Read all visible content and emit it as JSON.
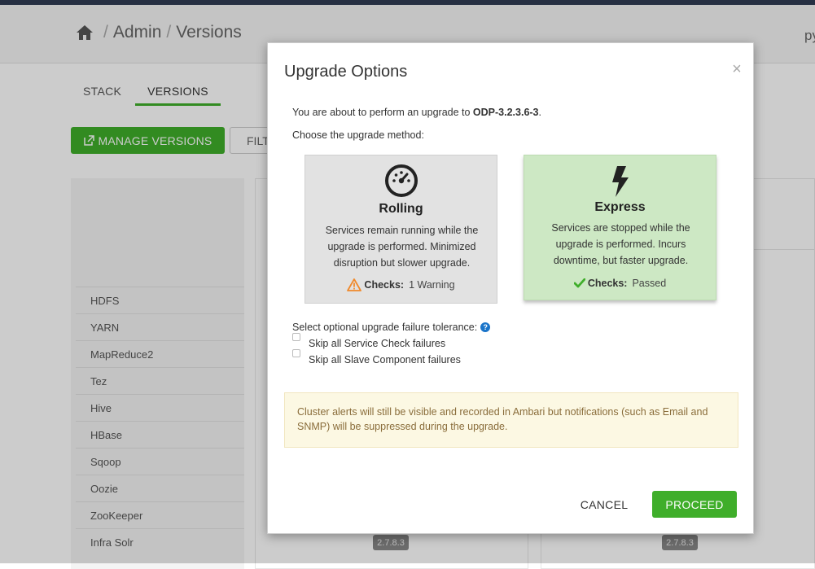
{
  "breadcrumb": {
    "home_icon": "home-icon",
    "items": [
      "Admin",
      "Versions"
    ],
    "separator": "/"
  },
  "header": {
    "user_text": "py"
  },
  "tabs": [
    {
      "label": "STACK",
      "active": false
    },
    {
      "label": "VERSIONS",
      "active": true
    }
  ],
  "toolbar": {
    "manage_versions_label": "MANAGE VERSIONS",
    "manage_versions_icon": "external-link-icon",
    "filter_label": "FILT"
  },
  "services": [
    "HDFS",
    "YARN",
    "MapReduce2",
    "Tez",
    "Hive",
    "HBase",
    "Sqoop",
    "Oozie",
    "ZooKeeper",
    "Infra Solr"
  ],
  "versions": {
    "infra_solr_version_col1": "2.7.8.3",
    "infra_solr_version_col2": "2.7.8.3"
  },
  "modal": {
    "title": "Upgrade Options",
    "close_icon": "close-icon",
    "intro_prefix": "You are about to perform an upgrade to ",
    "intro_version": "ODP-3.2.3.6-3",
    "intro_suffix": ".",
    "choose_text": "Choose the upgrade method:",
    "rolling": {
      "icon": "dashboard-gauge-icon",
      "name": "Rolling",
      "description": "Services remain running while the upgrade is performed. Minimized disruption but slower upgrade.",
      "checks_label": "Checks:",
      "checks_value": "1 Warning",
      "checks_icon": "warning-icon"
    },
    "express": {
      "icon": "lightning-bolt-icon",
      "name": "Express",
      "description": "Services are stopped while the upgrade is performed. Incurs downtime, but faster upgrade.",
      "checks_label": "Checks:",
      "checks_value": "Passed",
      "checks_icon": "checkmark-icon",
      "selected": true
    },
    "tolerance_label": "Select optional upgrade failure tolerance:",
    "tolerance_help_icon": "help-icon",
    "options": [
      {
        "label": "Skip all Service Check failures",
        "checked": false
      },
      {
        "label": "Skip all Slave Component failures",
        "checked": false
      }
    ],
    "alert_text": "Cluster alerts will still be visible and recorded in Ambari but notifications (such as Email and SNMP) will be suppressed during the upgrade.",
    "cancel_label": "CANCEL",
    "proceed_label": "PROCEED"
  },
  "colors": {
    "accent_green": "#3fae2a",
    "express_bg": "#cde8c4",
    "rolling_bg": "#e2e2e2",
    "warning_orange": "#f0892b",
    "alert_bg": "#fcf8e3",
    "alert_text": "#8a6d3b",
    "topbar": "#313d54"
  }
}
